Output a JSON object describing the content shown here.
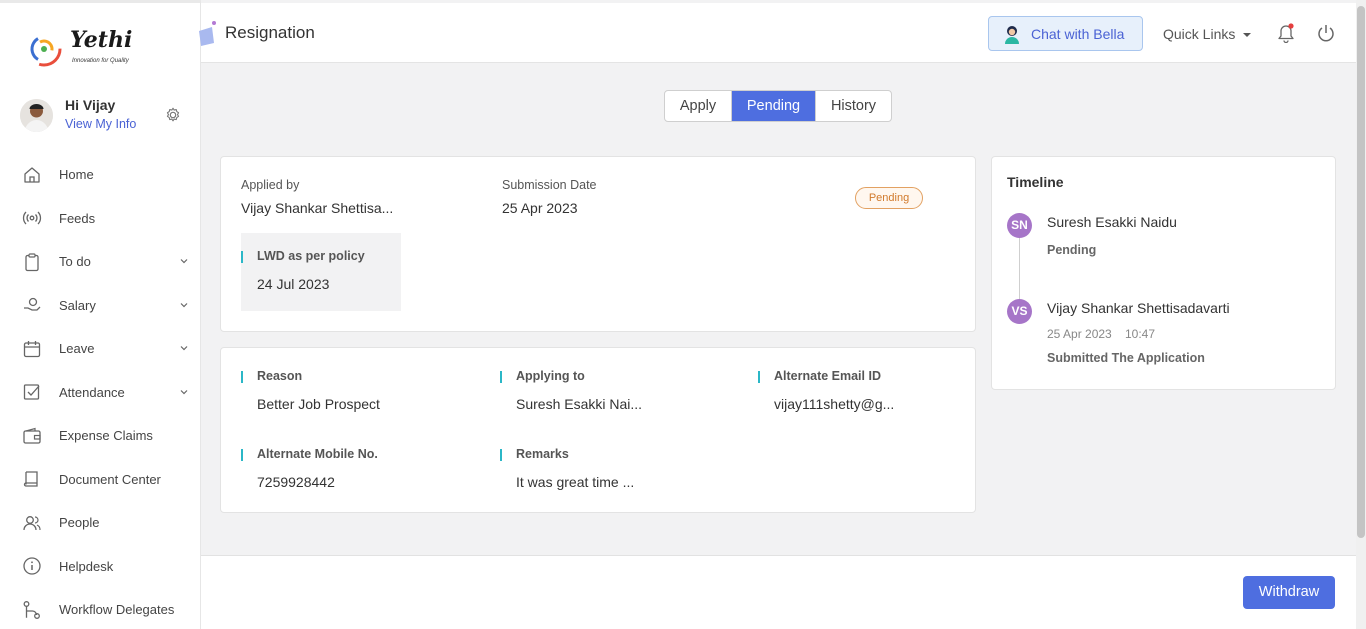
{
  "app": {
    "logo_text": "Yethi",
    "logo_tagline": "Innovation for Quality"
  },
  "profile": {
    "greeting": "Hi Vijay",
    "link": "View My Info"
  },
  "sidebar": {
    "items": [
      {
        "label": "Home",
        "icon": "home-icon",
        "expandable": false
      },
      {
        "label": "Feeds",
        "icon": "feeds-icon",
        "expandable": false
      },
      {
        "label": "To do",
        "icon": "clipboard-icon",
        "expandable": true
      },
      {
        "label": "Salary",
        "icon": "salary-icon",
        "expandable": true
      },
      {
        "label": "Leave",
        "icon": "calendar-icon",
        "expandable": true
      },
      {
        "label": "Attendance",
        "icon": "attendance-icon",
        "expandable": true
      },
      {
        "label": "Expense Claims",
        "icon": "wallet-icon",
        "expandable": false
      },
      {
        "label": "Document Center",
        "icon": "book-icon",
        "expandable": false
      },
      {
        "label": "People",
        "icon": "people-icon",
        "expandable": false
      },
      {
        "label": "Helpdesk",
        "icon": "info-icon",
        "expandable": false
      },
      {
        "label": "Workflow Delegates",
        "icon": "workflow-icon",
        "expandable": false
      }
    ]
  },
  "header": {
    "title": "Resignation",
    "chat_label": "Chat with Bella",
    "quick_links": "Quick Links"
  },
  "tabs": [
    {
      "label": "Apply",
      "active": false
    },
    {
      "label": "Pending",
      "active": true
    },
    {
      "label": "History",
      "active": false
    }
  ],
  "summary": {
    "applied_by_label": "Applied by",
    "applied_by_value": "Vijay Shankar Shettisa...",
    "submission_label": "Submission Date",
    "submission_value": "25 Apr 2023",
    "status_badge": "Pending",
    "lwd_label": "LWD as per policy",
    "lwd_value": "24 Jul 2023"
  },
  "details": {
    "reason_label": "Reason",
    "reason_value": "Better Job Prospect",
    "applying_label": "Applying to",
    "applying_value": "Suresh Esakki Nai...",
    "alt_email_label": "Alternate Email ID",
    "alt_email_value": "vijay111shetty@g...",
    "alt_mobile_label": "Alternate Mobile No.",
    "alt_mobile_value": "7259928442",
    "remarks_label": "Remarks",
    "remarks_value": "It was great time ..."
  },
  "timeline": {
    "title": "Timeline",
    "entries": [
      {
        "initials": "SN",
        "name": "Suresh Esakki Naidu",
        "date": "",
        "time": "",
        "status": "Pending"
      },
      {
        "initials": "VS",
        "name": "Vijay Shankar Shettisadavarti",
        "date": "25 Apr 2023",
        "time": "10:47",
        "status": "Submitted The Application"
      }
    ]
  },
  "footer": {
    "withdraw_label": "Withdraw"
  },
  "colors": {
    "accent": "#4e6ee0",
    "badge_orange": "#d17a2c",
    "timeline_avatar": "#a675c8",
    "field_bar": "#2bb7c7"
  }
}
